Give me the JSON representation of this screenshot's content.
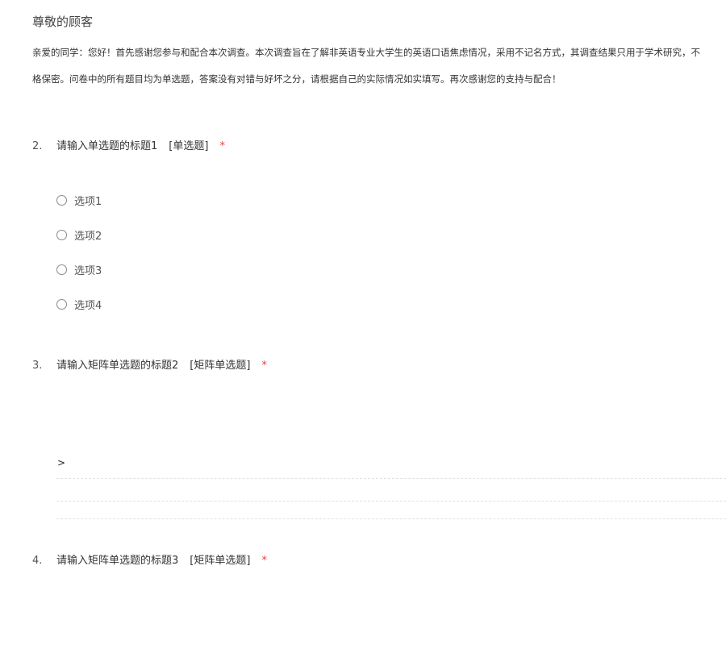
{
  "header": {
    "greeting": "尊敬的顾客",
    "intro_line1": "亲爱的同学：您好！首先感谢您参与和配合本次调查。本次调查旨在了解非英语专业大学生的英语口语焦虑情况，采用不记名方式，其调查结果只用于学术研究，不",
    "intro_line2": "格保密。问卷中的所有题目均为单选题，答案没有对错与好坏之分，请根据自己的实际情况如实填写。再次感谢您的支持与配合！"
  },
  "questions": [
    {
      "number": "2.",
      "title": "请输入单选题的标题1",
      "type": "[单选题]",
      "required_mark": "*",
      "options": [
        "选项1",
        "选项2",
        "选项3",
        "选项4"
      ]
    },
    {
      "number": "3.",
      "title": "请输入矩阵单选题的标题2",
      "type": "[矩阵单选题]",
      "required_mark": "*",
      "matrix_marker": ">"
    },
    {
      "number": "4.",
      "title": "请输入矩阵单选题的标题3",
      "type": "[矩阵单选题]",
      "required_mark": "*"
    }
  ],
  "colors": {
    "required": "#e8413c",
    "text": "#333333",
    "radio_border": "#8a8a8a",
    "divider": "#e2e2e2"
  }
}
